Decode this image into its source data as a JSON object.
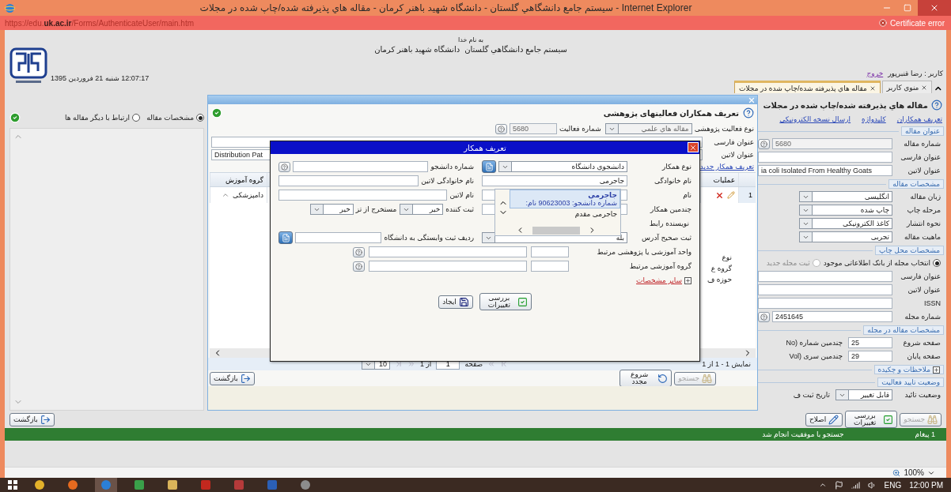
{
  "window": {
    "title": "Internet Explorer - سیستم جامع دانشگاهي گلستان - دانشگاه شهید باهنر کرمان - مقاله هاي پذيرفته شده/چاپ شده در مجلات"
  },
  "address_bar": {
    "url": "https://edu.**uk.ac.ir**/Forms/AuthenticateUser/main.htm",
    "security": "Certificate error"
  },
  "header": {
    "datetime": "12:07:17 شنبه 21 فروردین 1395",
    "blessing": "به نام خدا",
    "system": "سیستم جامع دانشگاهي گلستان",
    "university": "دانشگاه شهید باهنر کرمان",
    "user": "کاربر : رضا قنبرپور",
    "logout": "خروج"
  },
  "tabs": [
    {
      "label": "منوي کاربر",
      "selected": false
    },
    {
      "label": "مقاله هاي پذيرفته شده/چاپ شده در مجلات",
      "selected": true
    }
  ],
  "left_panel": {
    "views": [
      {
        "label": "مشخصات مقاله",
        "selected": true
      },
      {
        "label": "ارتباط با دیگر مقاله ها",
        "selected": false
      }
    ]
  },
  "activity_dialog": {
    "title": "تعریف همکاران فعالیتهای پژوهشی",
    "fields": [
      {
        "kind": "select",
        "label": "نوع فعالیت پژوهشی",
        "value": "مقاله هاي علمي",
        "disabled": true
      },
      {
        "kind": "input",
        "label": "شماره فعالیت",
        "value": "5680",
        "disabled": true,
        "help": true
      }
    ],
    "titles": [
      {
        "kind": "input",
        "label": "عنوان فارسی"
      },
      {
        "kind": "input",
        "label": "عنوان لاتین",
        "value": "Distribution Pat"
      }
    ],
    "new_link": "تعریف همکار جدید",
    "grid": {
      "columns": [
        "عملیات",
        "گروه آموزش"
      ],
      "rows": [
        {
          "number": "1",
          "group": "دامپزشکی"
        }
      ],
      "partial_labels": [
        "نوع",
        "گروه ع",
        "حوزه ف"
      ]
    },
    "pager": {
      "summary": "نمایش 1 - 1 از 1",
      "page_label": "صفحه",
      "page": "1",
      "of": "از 1",
      "page_size": "10"
    },
    "buttons": [
      {
        "kind": "search",
        "label": "جستجو",
        "disabled": true
      },
      {
        "kind": "restart",
        "label": "شروع مجدد"
      },
      {
        "kind": "back",
        "label": "بازگشت"
      }
    ]
  },
  "colleague_dialog": {
    "title": "تعریف همکار",
    "rows": [
      {
        "kind": "split",
        "right": [
          {
            "kind": "select",
            "label": "نوع همکار",
            "value": "دانشجوي دانشگاه",
            "lookup": true
          }
        ],
        "left": [
          {
            "kind": "input",
            "label": "شماره دانشجو",
            "help": true
          }
        ]
      },
      {
        "kind": "split",
        "right": [
          {
            "kind": "input",
            "label": "نام خانوادگی",
            "value": "جاجرمی"
          }
        ],
        "left": [
          {
            "kind": "input",
            "label": "نام خانوادگی لاتین"
          }
        ]
      },
      {
        "kind": "split",
        "right": [
          {
            "kind": "input",
            "label": "نام"
          }
        ],
        "left": [
          {
            "kind": "input",
            "label": "نام لاتین"
          }
        ]
      },
      {
        "kind": "split",
        "right": [
          {
            "kind": "input",
            "label": "چندمین همکار"
          }
        ],
        "left": [
          {
            "kind": "select",
            "label": "ثبت کننده",
            "value": "خیر"
          },
          {
            "kind": "select",
            "label": "مستخرج از تز",
            "value": "خیر"
          }
        ]
      },
      {
        "kind": "split",
        "right": [
          {
            "kind": "text",
            "label": "نویسنده رابط"
          }
        ]
      },
      {
        "kind": "split",
        "right": [
          {
            "kind": "select",
            "label": "ثبت صحیح آدرس",
            "value": "بله"
          }
        ],
        "left": [
          {
            "kind": "input",
            "label": "ردیف ثبت وابستگی به دانشگاه",
            "lookup": true
          }
        ]
      },
      {
        "kind": "unit",
        "label": "واحد آموزشی یا پژوهشی مرتبط",
        "help": true
      },
      {
        "kind": "unit",
        "label": "گروه آموزشی مرتبط",
        "help": true
      },
      {
        "kind": "expander",
        "label": "سایر مشخصات",
        "expanded": false
      }
    ],
    "buttons": [
      {
        "kind": "review",
        "label": "بررسی تغییرات"
      },
      {
        "kind": "create",
        "label": "ایجاد"
      }
    ]
  },
  "suggestions": [
    {
      "name": "جاجرمی",
      "detail": "شماره دانشجو: 90623003 نام:",
      "selected": true
    },
    {
      "name": "جاجرمی مقدم",
      "selected": false
    }
  ],
  "article_form": {
    "title": "مقاله هاي پذيرفته شده/چاپ شده در مجلات",
    "links": [
      "تعریف همکاران",
      "کلیدواژه",
      "ارسال نسخه الکترونیکی"
    ],
    "sections": [
      {
        "kind": "fieldset",
        "legend": "عنوان مقاله",
        "rows": [
          {
            "fields": [
              {
                "kind": "input",
                "label": "شماره مقاله",
                "value": "5680",
                "disabled": true,
                "help": true
              }
            ]
          },
          {
            "fields": [
              {
                "kind": "input",
                "label": "عنوان فارسی"
              }
            ]
          },
          {
            "fields": [
              {
                "kind": "input",
                "label": "عنوان لاتین",
                "value": "ia coli Isolated From Healthy Goats"
              }
            ]
          }
        ]
      },
      {
        "kind": "fieldset",
        "legend": "مشخصات مقاله",
        "rows": [
          {
            "fields": [
              {
                "kind": "select",
                "label": "زبان مقاله",
                "value": "انگلیسی"
              }
            ]
          },
          {
            "fields": [
              {
                "kind": "select",
                "label": "مرحله چاپ",
                "value": "چاپ شده"
              }
            ]
          },
          {
            "fields": [
              {
                "kind": "select",
                "label": "نحوه انتشار",
                "value": "کاغذ الکترونیکی"
              }
            ]
          },
          {
            "fields": [
              {
                "kind": "select",
                "label": "ماهیت مقاله",
                "value": "تجربی"
              }
            ]
          }
        ]
      },
      {
        "kind": "fieldset",
        "legend": "مشخصات محل چاپ",
        "rows": [
          {
            "fields": [
              {
                "kind": "radio",
                "label": "انتخاب مجله از بانک اطلاعاتی موجود",
                "selected": true
              },
              {
                "kind": "radio",
                "label": "ثبت مجله جدید",
                "selected": false,
                "disabled": true
              }
            ]
          },
          {
            "fields": [
              {
                "kind": "input",
                "label": "عنوان فارسی"
              }
            ]
          },
          {
            "fields": [
              {
                "kind": "input",
                "label": "عنوان لاتین"
              }
            ]
          },
          {
            "fields": [
              {
                "kind": "input",
                "label": "ISSN"
              }
            ]
          },
          {
            "fields": [
              {
                "kind": "input",
                "label": "شماره مجله",
                "value": "2451645",
                "help": true
              }
            ]
          }
        ]
      },
      {
        "kind": "fieldset",
        "legend": "مشخصات مقاله در مجله",
        "rows": [
          {
            "fields": [
              {
                "kind": "input",
                "label": "صفحه شروع",
                "value": "25"
              },
              {
                "kind": "text",
                "label": "چندمین شماره (No"
              }
            ]
          },
          {
            "fields": [
              {
                "kind": "input",
                "label": "صفحه پایان",
                "value": "29"
              },
              {
                "kind": "text",
                "label": "چندمین سری (Vol"
              }
            ]
          }
        ]
      },
      {
        "kind": "expander",
        "legend": "ملاحظات و چکیده",
        "expanded": false
      },
      {
        "kind": "fieldset",
        "legend": "وضعیت تایید فعالیت",
        "rows": [
          {
            "fields": [
              {
                "kind": "select",
                "label": "وضعیت تائید",
                "value": "قابل تغییر"
              },
              {
                "kind": "text",
                "label": "تاریخ ثبت ف"
              }
            ]
          }
        ]
      }
    ]
  },
  "page_actions": [
    {
      "kind": "search",
      "label": "جستجو",
      "disabled": true
    },
    {
      "kind": "review",
      "label": "بررسی تغییرات"
    },
    {
      "kind": "edit",
      "label": "اصلاح"
    },
    {
      "kind": "back",
      "label": "بازگشت"
    }
  ],
  "message_bar": {
    "count": "1 پیغام",
    "text": "جستجو با موفقیت انجام شد"
  },
  "status_bar": {
    "zoom": "100%"
  },
  "taskbar": {
    "language": "ENG",
    "time": "12:00 PM"
  }
}
